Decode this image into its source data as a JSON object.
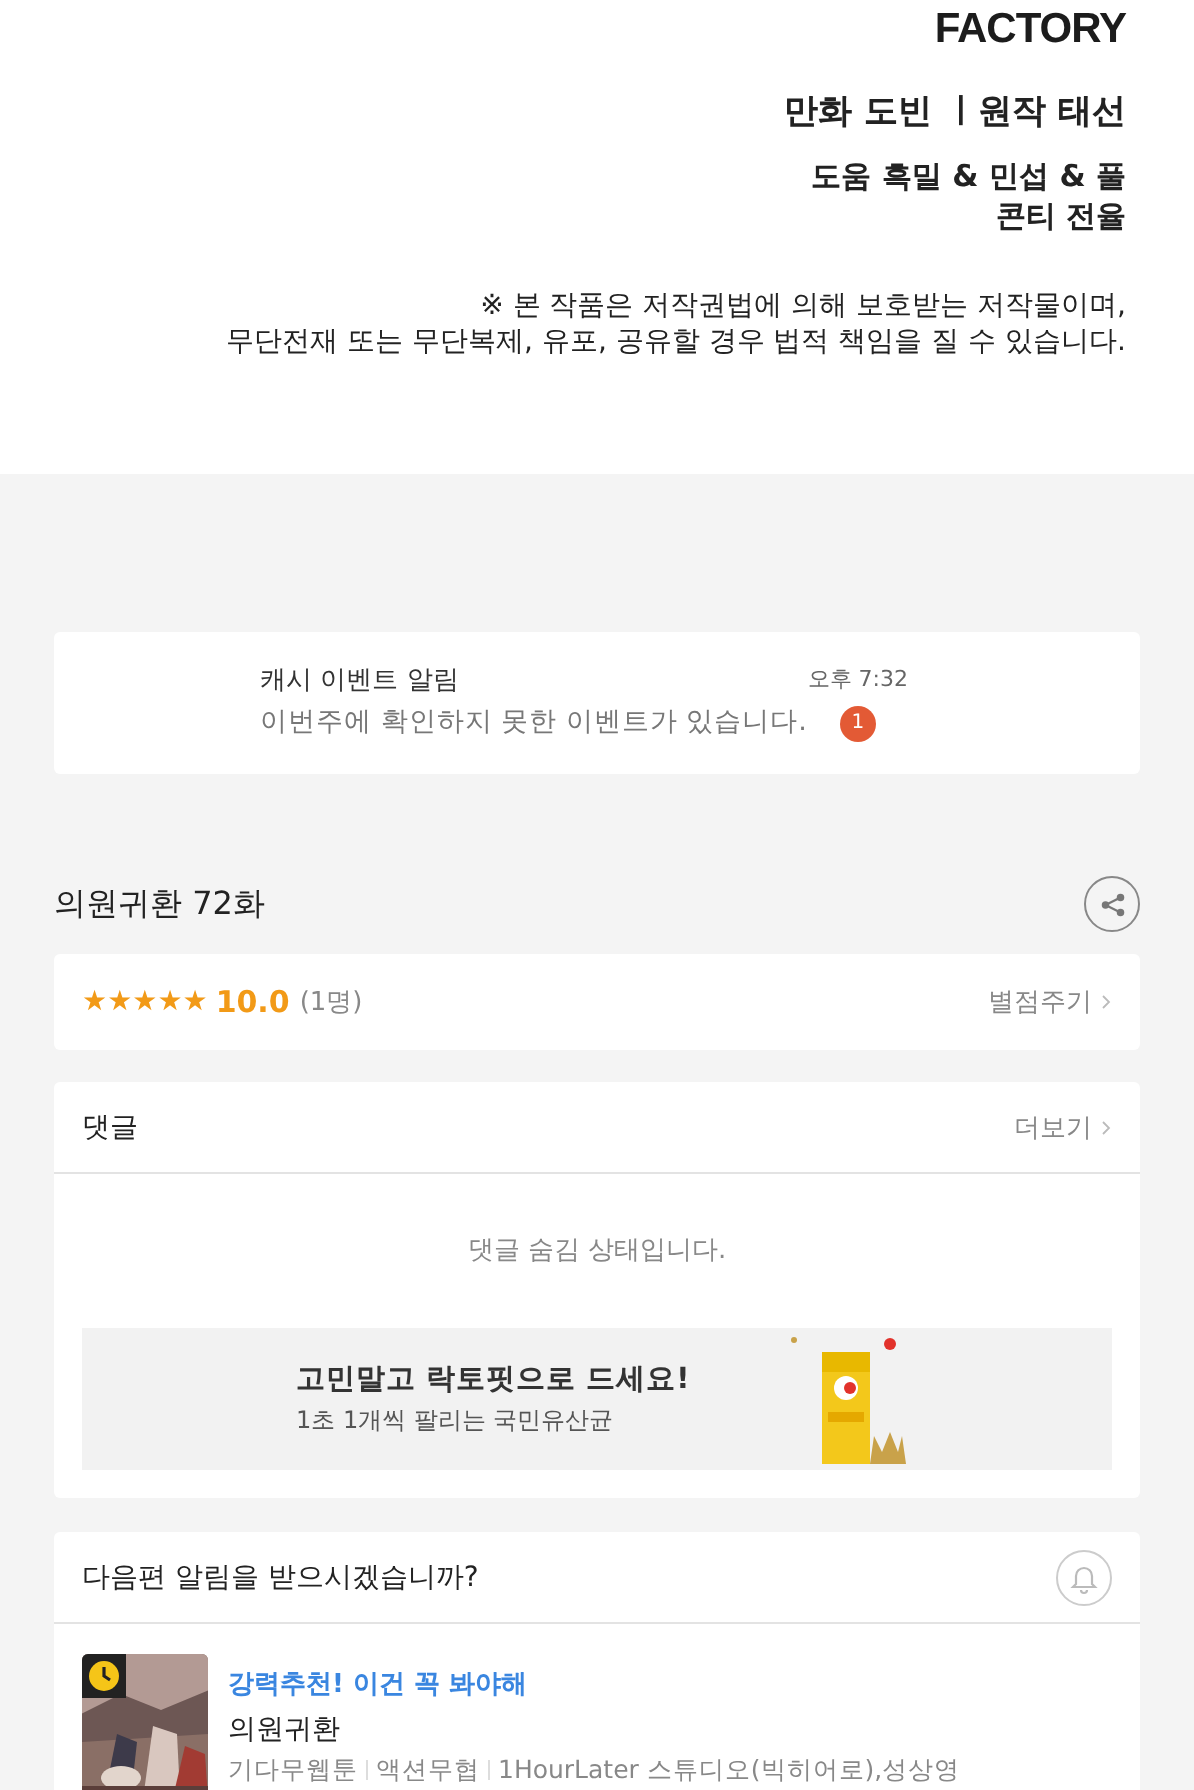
{
  "header": {
    "logo": "FACTORY",
    "credits": [
      "만화 도빈 ㅣ원작 태선",
      "도움 흑밀 & 민섭 & 풀",
      "콘티 전율"
    ],
    "notice": [
      "※ 본 작품은 저작권법에 의해 보호받는 저작물이며,",
      "무단전재 또는 무단복제, 유포, 공유할 경우 법적 책임을 질 수 있습니다."
    ]
  },
  "notification": {
    "title": "캐시 이벤트 알림",
    "message": "이번주에 확인하지 못한 이벤트가 있습니다.",
    "time": "오후 7:32",
    "count": "1"
  },
  "episode": {
    "title": "의원귀환 72화"
  },
  "rating": {
    "stars": 5,
    "score": "10.0",
    "count": "(1명)",
    "action": "별점주기"
  },
  "comments": {
    "title": "댓글",
    "more": "더보기",
    "message": "댓글 숨김 상태입니다.",
    "ad": {
      "title": "고민말고 락토핏으로 드세요!",
      "subtitle": "1초 1개씩 팔리는 국민유산균"
    }
  },
  "next_alert": {
    "question": "다음편 알림을 받으시겠습니까?"
  },
  "recommendation": {
    "tag": "강력추천! 이건 꼭 봐야해",
    "title": "의원귀환",
    "meta": [
      "기다무웹툰",
      "액션무협",
      "1HourLater 스튜디오(빅히어로),성상영"
    ]
  }
}
